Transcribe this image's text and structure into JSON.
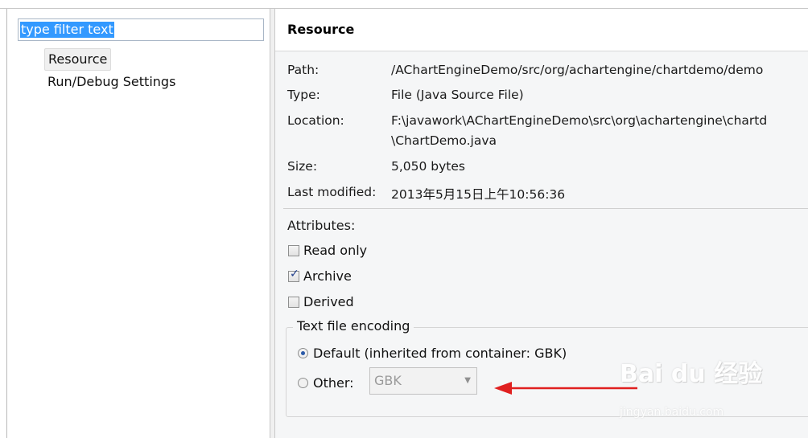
{
  "filter": {
    "value": "type filter text"
  },
  "tree": [
    {
      "label": "Resource"
    },
    {
      "label": "Run/Debug Settings"
    }
  ],
  "panel": {
    "title": "Resource"
  },
  "info": {
    "path_label": "Path:",
    "path_value": "/AChartEngineDemo/src/org/achartengine/chartdemo/demo",
    "type_label": "Type:",
    "type_value": "File  (Java Source File)",
    "location_label": "Location:",
    "location_value_1": "F:\\javawork\\AChartEngineDemo\\src\\org\\achartengine\\chartd",
    "location_value_2": "\\ChartDemo.java",
    "size_label": "Size:",
    "size_value": "5,050  bytes",
    "modified_label": "Last modified:",
    "modified_value": "2013年5月15日上午10:56:36"
  },
  "attributes": {
    "label": "Attributes:",
    "read_only": {
      "label": "Read only",
      "checked": false
    },
    "archive": {
      "label": "Archive",
      "checked": true
    },
    "derived": {
      "label": "Derived",
      "checked": false
    }
  },
  "encoding": {
    "legend": "Text file encoding",
    "default_label": "Default (inherited from container: GBK)",
    "other_label": "Other:",
    "other_value": "GBK",
    "selected": "default"
  },
  "watermark": {
    "brand": "Bai du 经验",
    "url": "jingyan.baidu.com"
  }
}
